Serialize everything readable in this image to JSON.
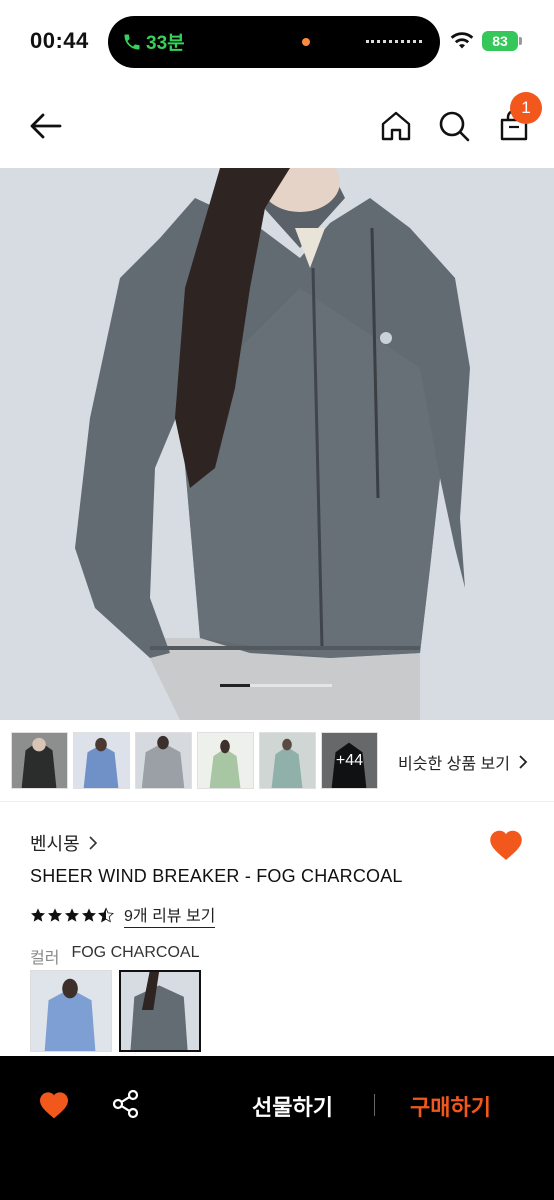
{
  "status_bar": {
    "time": "00:44",
    "call_duration": "33분",
    "battery": "83"
  },
  "nav": {
    "cart_count": "1",
    "icons": [
      "back-arrow-icon",
      "home-icon",
      "search-icon",
      "shopping-bag-icon"
    ]
  },
  "gallery": {
    "more_count": "+44",
    "similar_label": "비슷한 상품 보기"
  },
  "product": {
    "brand": "벤시몽",
    "title": "SHEER WIND BREAKER - FOG CHARCOAL",
    "rating": 4.5,
    "review_link": "9개 리뷰 보기",
    "color_label": "컬러",
    "color_value": "FOG CHARCOAL"
  },
  "bottom_bar": {
    "gift_label": "선물하기",
    "buy_label": "구매하기"
  },
  "colors": {
    "accent": "#f2581c",
    "bottom_bar_bg": "#000000"
  }
}
